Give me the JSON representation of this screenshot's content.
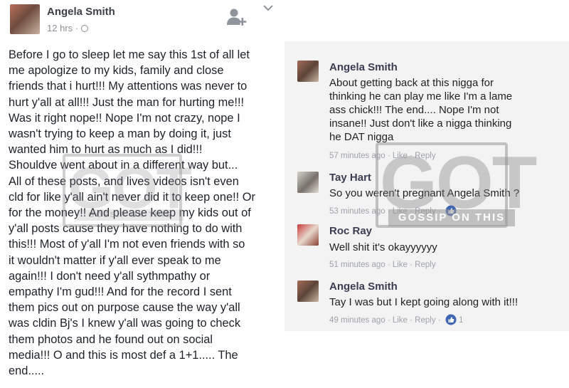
{
  "post": {
    "author": "Angela Smith",
    "time": "12 hrs · ",
    "body": "Before I go to sleep let me say this 1st of all let\nme apologize to my kids, family and close\nfriends that i hurt!!! My attentions was never to\nhurt y'all at all!!! Just the man for hurting me!!!\nWas it right nope!! Nope I'm not crazy, nope I\nwasn't trying to keep a man by doing it, just\nwanted him to hurt as much as I did!!!\nShouldve went about in a different way but...\nAll of these posts, and lives videos isn't even\ncld for like y'all ain't never did it to keep one!! Or\nfor the money!! And please keep my kids out of\ny'all posts cause they have nothing to do with\nthis!!! Most of y'all I'm not even friends with so\nit wouldn't matter if y'all ever speak to me\nagain!!! I don't need y'all sythmpathy or\nempathy I'm gud!!! And for the record I sent\nthem pics out on purpose cause the way y'all\nwas cldin Bj's I knew y'all was going to check\nthem photos and he found out on social\nmedia!!! O and this is most def a 1+1..... The\nend....."
  },
  "comments": [
    {
      "author": "Angela Smith",
      "text": "About getting back at this nigga for\nthinking he can play me like I'm a lame\nass chick!!! The end.... Nope I'm not\ninsane!! Just don't like a nigga thinking\nhe DAT nigga",
      "meta": "57 minutes ago · Like · Reply"
    },
    {
      "author": "Tay Hart",
      "text": "So you weren't pregnant Angela Smith ?",
      "meta": "53 minutes ago · Like · Reply ·"
    },
    {
      "author": "Roc Ray",
      "text": "Well shit it's okayyyyyy",
      "meta": "51 minutes ago · Like · Reply"
    },
    {
      "author": "Angela Smith",
      "text": "Tay I was but I kept going along with it!!!",
      "meta": "49 minutes ago · Like · Reply ·",
      "likes": "1"
    }
  ],
  "watermark": {
    "letters": "GOT",
    "tagline": "GOSSIP ON THIS"
  },
  "icons": {
    "add_friend": "add-friend-icon",
    "menu": "chevron-down-icon",
    "audience": "globe-icon",
    "like": "like-icon"
  },
  "colors": {
    "name": "#3b3f46",
    "meta": "#8c9098",
    "like_blue": "#4267b2",
    "panel_bg": "#f3f3f3"
  }
}
